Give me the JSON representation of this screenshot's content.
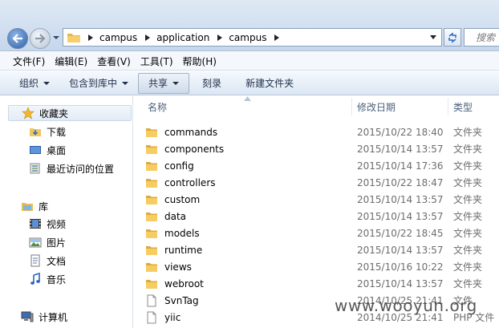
{
  "address": {
    "crumbs": [
      "campus",
      "application",
      "campus"
    ],
    "search_placeholder": "搜索"
  },
  "menu": [
    "文件(F)",
    "编辑(E)",
    "查看(V)",
    "工具(T)",
    "帮助(H)"
  ],
  "commands": {
    "organize": "组织",
    "include_in_library": "包含到库中",
    "share": "共享",
    "burn": "刻录",
    "new_folder": "新建文件夹"
  },
  "nav": {
    "favorites": "收藏夹",
    "downloads": "下载",
    "desktop": "桌面",
    "recent": "最近访问的位置",
    "libraries": "库",
    "videos": "视频",
    "pictures": "图片",
    "documents": "文档",
    "music": "音乐",
    "computer": "计算机"
  },
  "columns": {
    "name": "名称",
    "date": "修改日期",
    "type": "类型"
  },
  "files": [
    {
      "name": "commands",
      "date": "2015/10/22 18:40",
      "type": "文件夹",
      "icon": "folder-icon"
    },
    {
      "name": "components",
      "date": "2015/10/14 13:57",
      "type": "文件夹",
      "icon": "folder-icon"
    },
    {
      "name": "config",
      "date": "2015/10/14 17:36",
      "type": "文件夹",
      "icon": "folder-icon"
    },
    {
      "name": "controllers",
      "date": "2015/10/22 18:47",
      "type": "文件夹",
      "icon": "folder-icon"
    },
    {
      "name": "custom",
      "date": "2015/10/14 13:57",
      "type": "文件夹",
      "icon": "folder-icon"
    },
    {
      "name": "data",
      "date": "2015/10/14 13:57",
      "type": "文件夹",
      "icon": "folder-icon"
    },
    {
      "name": "models",
      "date": "2015/10/22 18:45",
      "type": "文件夹",
      "icon": "folder-icon"
    },
    {
      "name": "runtime",
      "date": "2015/10/14 13:57",
      "type": "文件夹",
      "icon": "folder-icon"
    },
    {
      "name": "views",
      "date": "2015/10/16 10:22",
      "type": "文件夹",
      "icon": "folder-icon"
    },
    {
      "name": "webroot",
      "date": "2015/10/14 13:57",
      "type": "文件夹",
      "icon": "folder-icon"
    },
    {
      "name": "SvnTag",
      "date": "2014/10/25 21:41",
      "type": "文件",
      "icon": "file-icon"
    },
    {
      "name": "yiic",
      "date": "2014/10/25 21:41",
      "type": "PHP 文件",
      "icon": "file-icon"
    }
  ],
  "watermark": "www.wooyun.org"
}
